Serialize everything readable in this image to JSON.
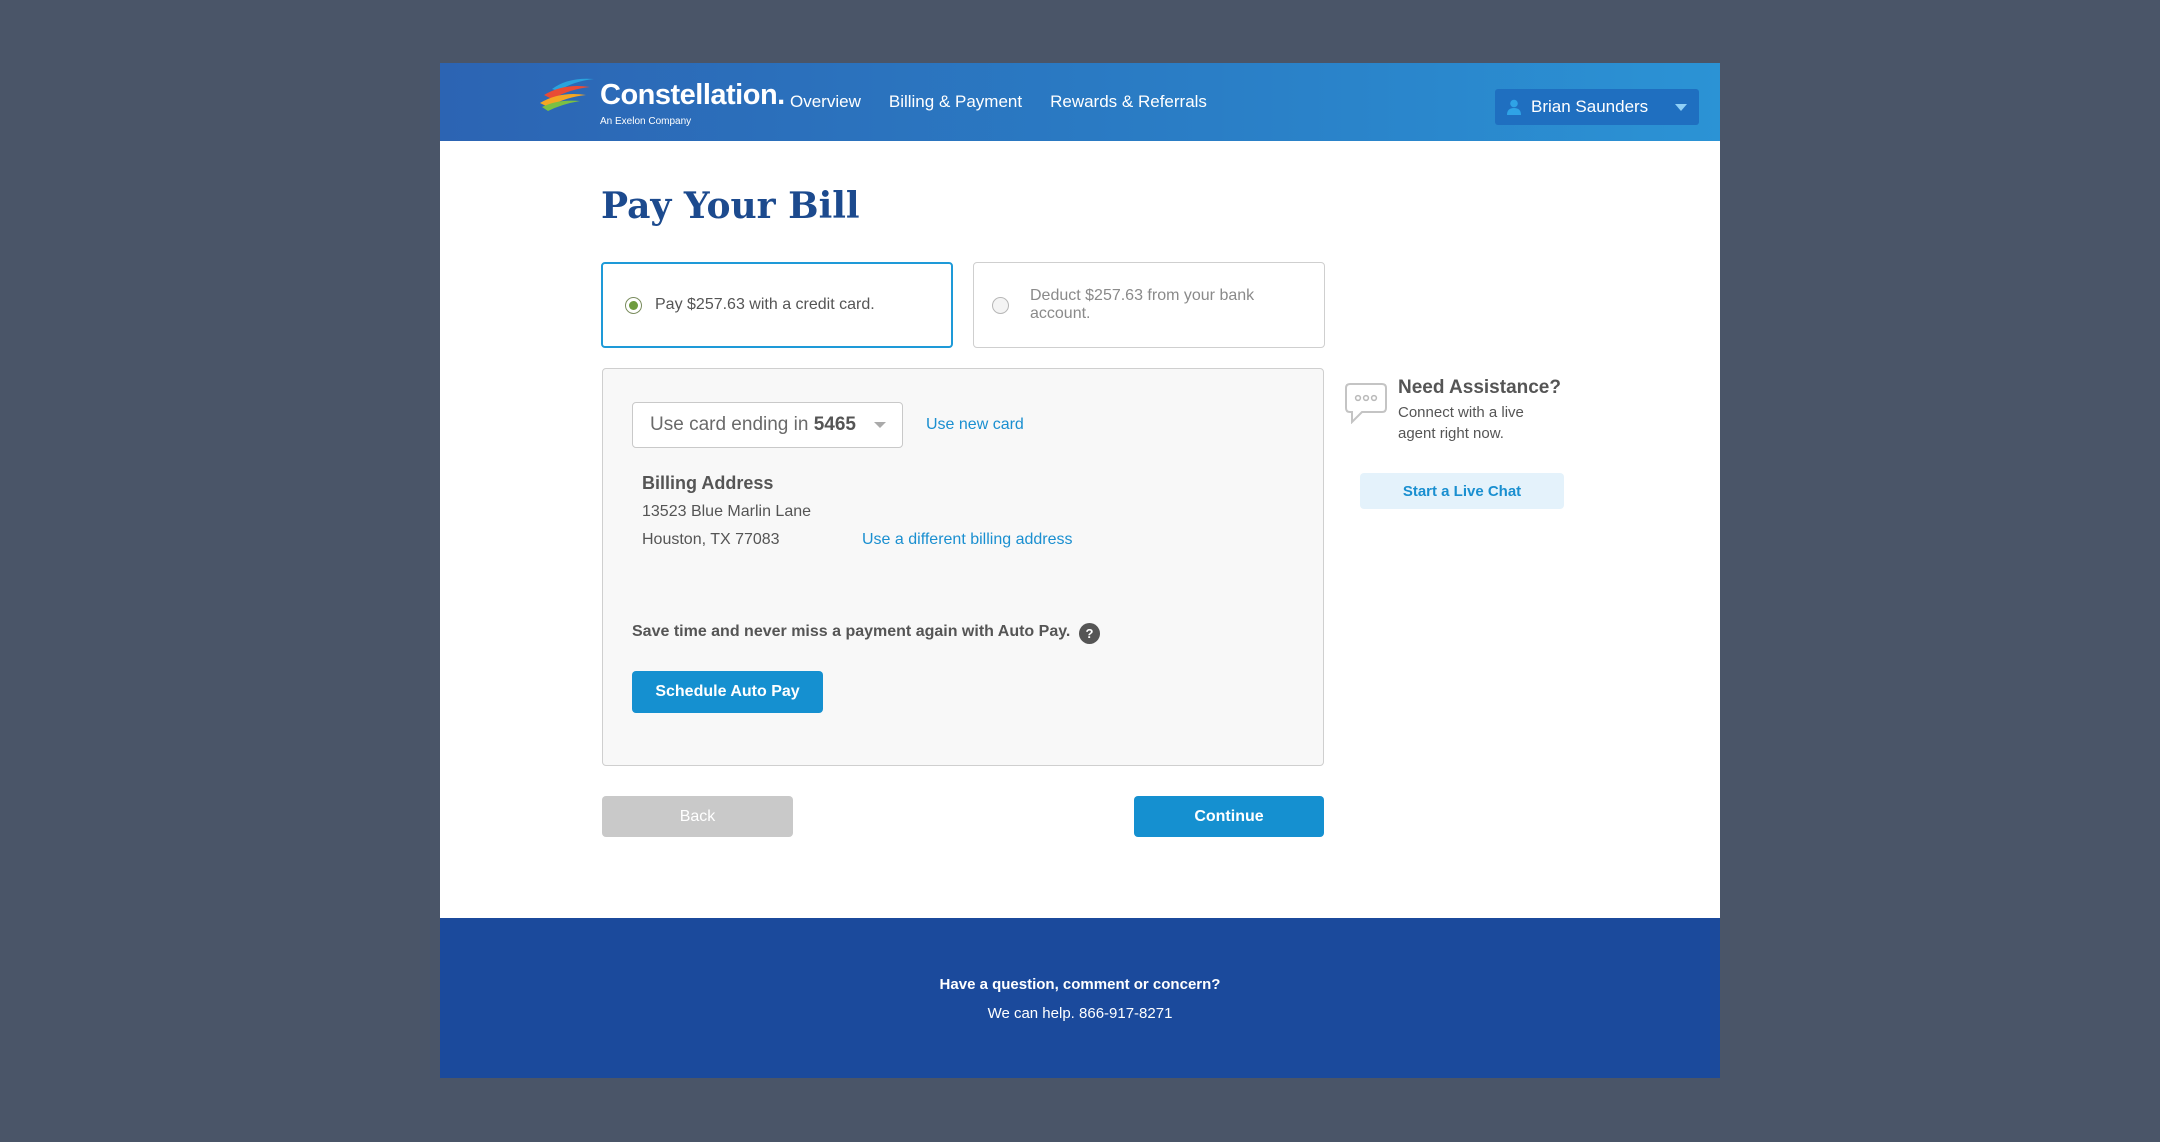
{
  "header": {
    "logo_name": "Constellation.",
    "logo_sub": "An Exelon Company",
    "nav": [
      {
        "label": "Overview"
      },
      {
        "label": "Billing & Payment"
      },
      {
        "label": "Rewards & Referrals"
      }
    ],
    "user": {
      "name": "Brian Saunders",
      "icon": "user-icon"
    }
  },
  "main": {
    "title": "Pay Your Bill",
    "payment_options": [
      {
        "label": "Pay $257.63 with a credit card.",
        "selected": true
      },
      {
        "label": "Deduct $257.63 from your bank account.",
        "selected": false
      }
    ],
    "card": {
      "select_prefix": "Use card ending in",
      "select_last4": "5465",
      "use_new_card": "Use new card"
    },
    "billing": {
      "title": "Billing Address",
      "line1": "13523 Blue Marlin Lane",
      "line2": "Houston, TX 77083",
      "change_link": "Use a different billing address"
    },
    "autopay": {
      "text": "Save time and never miss a payment again with Auto Pay.",
      "help": "?",
      "button": "Schedule Auto Pay"
    },
    "back_label": "Back",
    "continue_label": "Continue"
  },
  "assist": {
    "title": "Need Assistance?",
    "text": "Connect with a live agent right now.",
    "button": "Start a Live Chat"
  },
  "footer": {
    "question": "Have a question, comment or concern?",
    "phone_line": "We can help. 866-917-8271"
  },
  "colors": {
    "brand_blue": "#1c4a8e",
    "accent": "#1590d0",
    "footer_bg": "#1b4a9c",
    "page_bg": "#4a5568"
  }
}
